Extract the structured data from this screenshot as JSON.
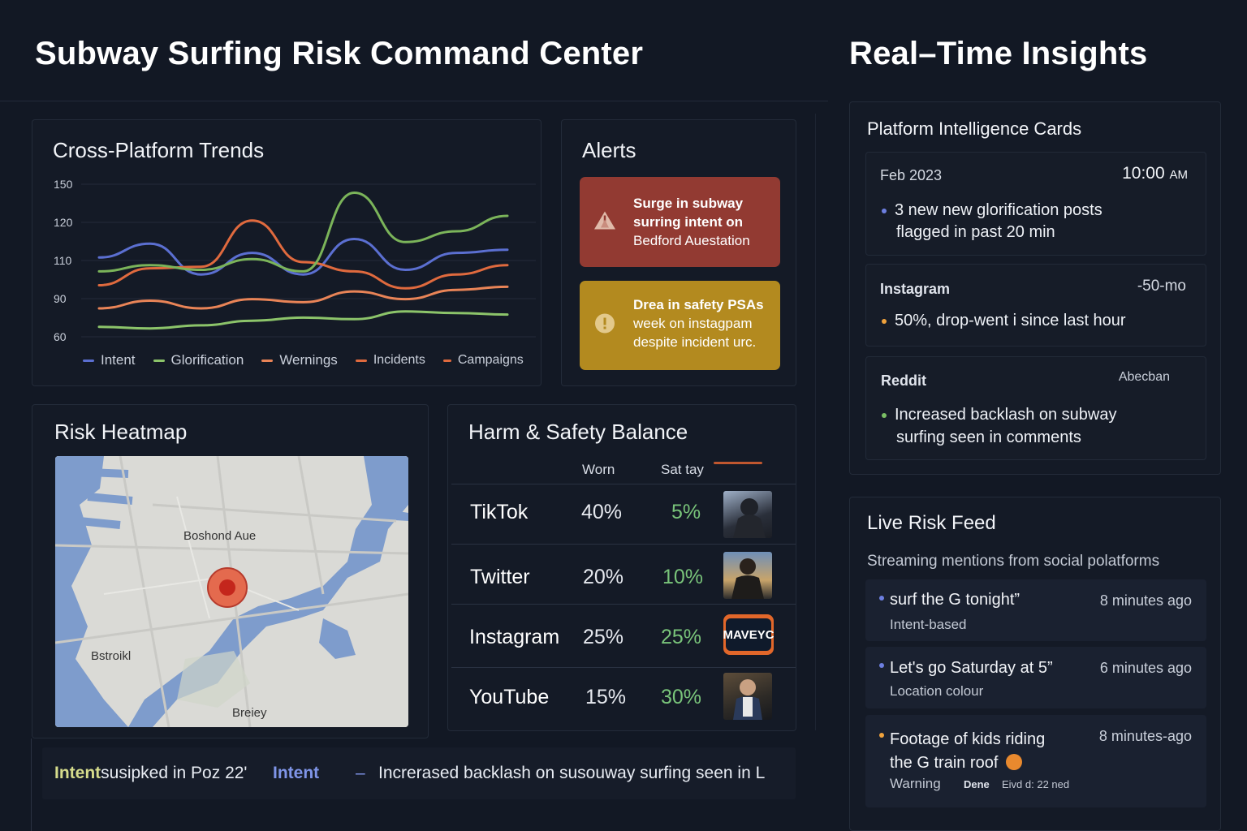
{
  "header": {
    "title": "Subway Surfing Risk Command Center",
    "right_title": "Real–Time Insights"
  },
  "trends": {
    "title": "Cross-Platform Trends",
    "y_ticks": [
      "150",
      "120",
      "110",
      "90",
      "60"
    ],
    "legend": [
      {
        "label": "Intent",
        "color": "#5b6fd1"
      },
      {
        "label": "Glorification",
        "color": "#8cc46a"
      },
      {
        "label": "Wernings",
        "color": "#e98457"
      },
      {
        "label": "Incidents",
        "color": "#e06a3e"
      },
      {
        "label": "Campaigns",
        "color": "#e06a3e"
      }
    ]
  },
  "chart_data": {
    "type": "line",
    "title": "Cross-Platform Trends",
    "xlabel": "",
    "ylabel": "",
    "y_ticks": [
      150,
      120,
      110,
      90,
      60
    ],
    "grid": true,
    "legend_position": "bottom",
    "series": [
      {
        "name": "Intent",
        "color": "#5b6fd1",
        "values": [
          0.53,
          0.62,
          0.42,
          0.56,
          0.42,
          0.65,
          0.45,
          0.56,
          0.58
        ]
      },
      {
        "name": "Glorification",
        "color": "#8cc46a",
        "values": [
          0.08,
          0.07,
          0.09,
          0.12,
          0.14,
          0.13,
          0.18,
          0.17,
          0.16
        ]
      },
      {
        "name": "Wernings",
        "color": "#e98457",
        "values": [
          0.2,
          0.25,
          0.2,
          0.26,
          0.24,
          0.31,
          0.26,
          0.32,
          0.34
        ]
      },
      {
        "name": "Incidents",
        "color": "#e06a3e",
        "values": [
          0.35,
          0.46,
          0.47,
          0.77,
          0.5,
          0.44,
          0.33,
          0.42,
          0.48
        ]
      },
      {
        "name": "Campaigns",
        "color": "#7bb45a",
        "values": [
          0.44,
          0.48,
          0.45,
          0.52,
          0.44,
          0.95,
          0.63,
          0.7,
          0.8
        ]
      }
    ]
  },
  "alerts": {
    "title": "Alerts",
    "items": [
      {
        "line1": "Surge in subway",
        "line2": "surring intent on",
        "line3": "Bedford Auestation",
        "color": "#923a32"
      },
      {
        "line1": "Drea in safety PSAs",
        "line2": "week on instagpam",
        "line3": "despite incident urc.",
        "color": "#b38a1f"
      }
    ]
  },
  "heatmap": {
    "title": "Risk Heatmap",
    "labels": [
      "Boshond Aue",
      "Bstroikl",
      "Breiey"
    ]
  },
  "balance": {
    "title": "Harm & Safety Balance",
    "col1": "Worn",
    "col2": "Sat tay",
    "rows": [
      {
        "platform": "TikTok",
        "worn": "40%",
        "safety": "5%"
      },
      {
        "platform": "Twitter",
        "worn": "20%",
        "safety": "10%"
      },
      {
        "platform": "Instagram",
        "worn": "25%",
        "safety": "25%",
        "thumb_text": "MAVEYC"
      },
      {
        "platform": "YouTube",
        "worn": "15%",
        "safety": "30%"
      }
    ]
  },
  "ticker": {
    "tag1": "Intent",
    "text1": "ѕusipked in Poz 22'",
    "tag2": "Intent",
    "dash": "–",
    "text2": "Increrased backlash on susouway surfing seen in L"
  },
  "intel": {
    "title": "Platform Intelligence Cards",
    "cards": [
      {
        "source": "Feb 2023",
        "time": "10:00",
        "ampm": "AM",
        "line1": "3 new new glorification posts",
        "line2": "flagged in past 20 min",
        "bullet_color": "#6d7fe0"
      },
      {
        "source": "Instagram",
        "time": "-50-mo",
        "line1": "50%, drop-went i since last hour",
        "line2": "",
        "bullet_color": "#f0a23c"
      },
      {
        "source": "Reddit",
        "time": "Abecban",
        "line1": "Increased backlash on subway",
        "line2": "surfing seen in comments",
        "bullet_color": "#7bbf65"
      }
    ]
  },
  "feed": {
    "title": "Live Risk Feed",
    "subtitle": "Streaming mentions from social polatforms",
    "items": [
      {
        "text": "surf the G tonight”",
        "time": "8 minutes ago",
        "tag": "Intent-based",
        "bullet_color": "#6d7fe0"
      },
      {
        "text": "Let's go Saturday at 5”",
        "time": "6 minutes ago",
        "tag": "Location colour",
        "bullet_color": "#6d7fe0"
      },
      {
        "text": "Footage of kids riding",
        "text2": "the G train roof",
        "time": "8 minutes-ago",
        "tag": "Warning",
        "tag2": "Dene",
        "tag3": "Eivd d: 22 ned",
        "bullet_color": "#f0a23c"
      }
    ]
  }
}
